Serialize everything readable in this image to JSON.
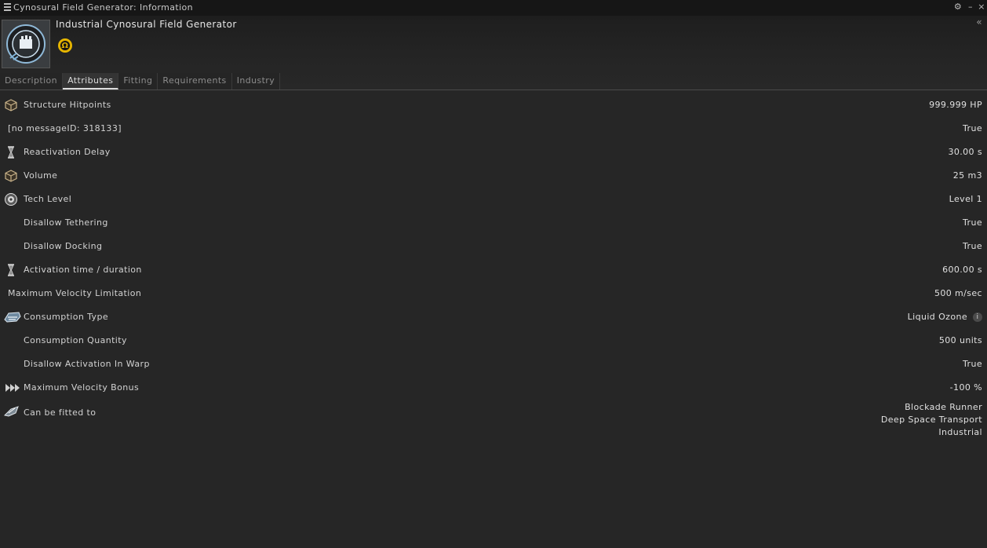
{
  "window": {
    "title": "Cynosural Field Generator: Information",
    "controls": {
      "settings": "⚙",
      "minimize": "–",
      "close": "×"
    }
  },
  "item": {
    "name": "Industrial Cynosural Field Generator",
    "omega_symbol": "Ω",
    "collapse_symbol": "«"
  },
  "tabs": [
    {
      "label": "Description",
      "active": false
    },
    {
      "label": "Attributes",
      "active": true
    },
    {
      "label": "Fitting",
      "active": false
    },
    {
      "label": "Requirements",
      "active": false
    },
    {
      "label": "Industry",
      "active": false
    }
  ],
  "attributes": [
    {
      "label": "Structure Hitpoints",
      "value": "999.999 HP",
      "icon": "cube-icon"
    },
    {
      "label": "[no messageID: 318133]",
      "value": "True",
      "icon": null
    },
    {
      "label": "Reactivation Delay",
      "value": "30.00 s",
      "icon": "hourglass-icon"
    },
    {
      "label": "Volume",
      "value": "25 m3",
      "icon": "cube-icon"
    },
    {
      "label": "Tech Level",
      "value": "Level 1",
      "icon": "tech-level-icon"
    },
    {
      "label": "Disallow Tethering",
      "value": "True",
      "icon": null
    },
    {
      "label": "Disallow Docking",
      "value": "True",
      "icon": null
    },
    {
      "label": "Activation time / duration",
      "value": "600.00 s",
      "icon": "hourglass-icon"
    },
    {
      "label": "Maximum Velocity Limitation",
      "value": "500 m/sec",
      "icon": null
    },
    {
      "label": "Consumption Type",
      "value": "Liquid Ozone",
      "icon": "fuel-icon",
      "info": "i"
    },
    {
      "label": "Consumption Quantity",
      "value": "500 units",
      "icon": null
    },
    {
      "label": "Disallow Activation In Warp",
      "value": "True",
      "icon": null
    },
    {
      "label": "Maximum Velocity Bonus",
      "value": "-100 %",
      "icon": "velocity-icon"
    },
    {
      "label": "Can be fitted to",
      "values": [
        "Blockade Runner",
        "Deep Space Transport",
        "Industrial"
      ],
      "icon": "ship-icon"
    }
  ]
}
